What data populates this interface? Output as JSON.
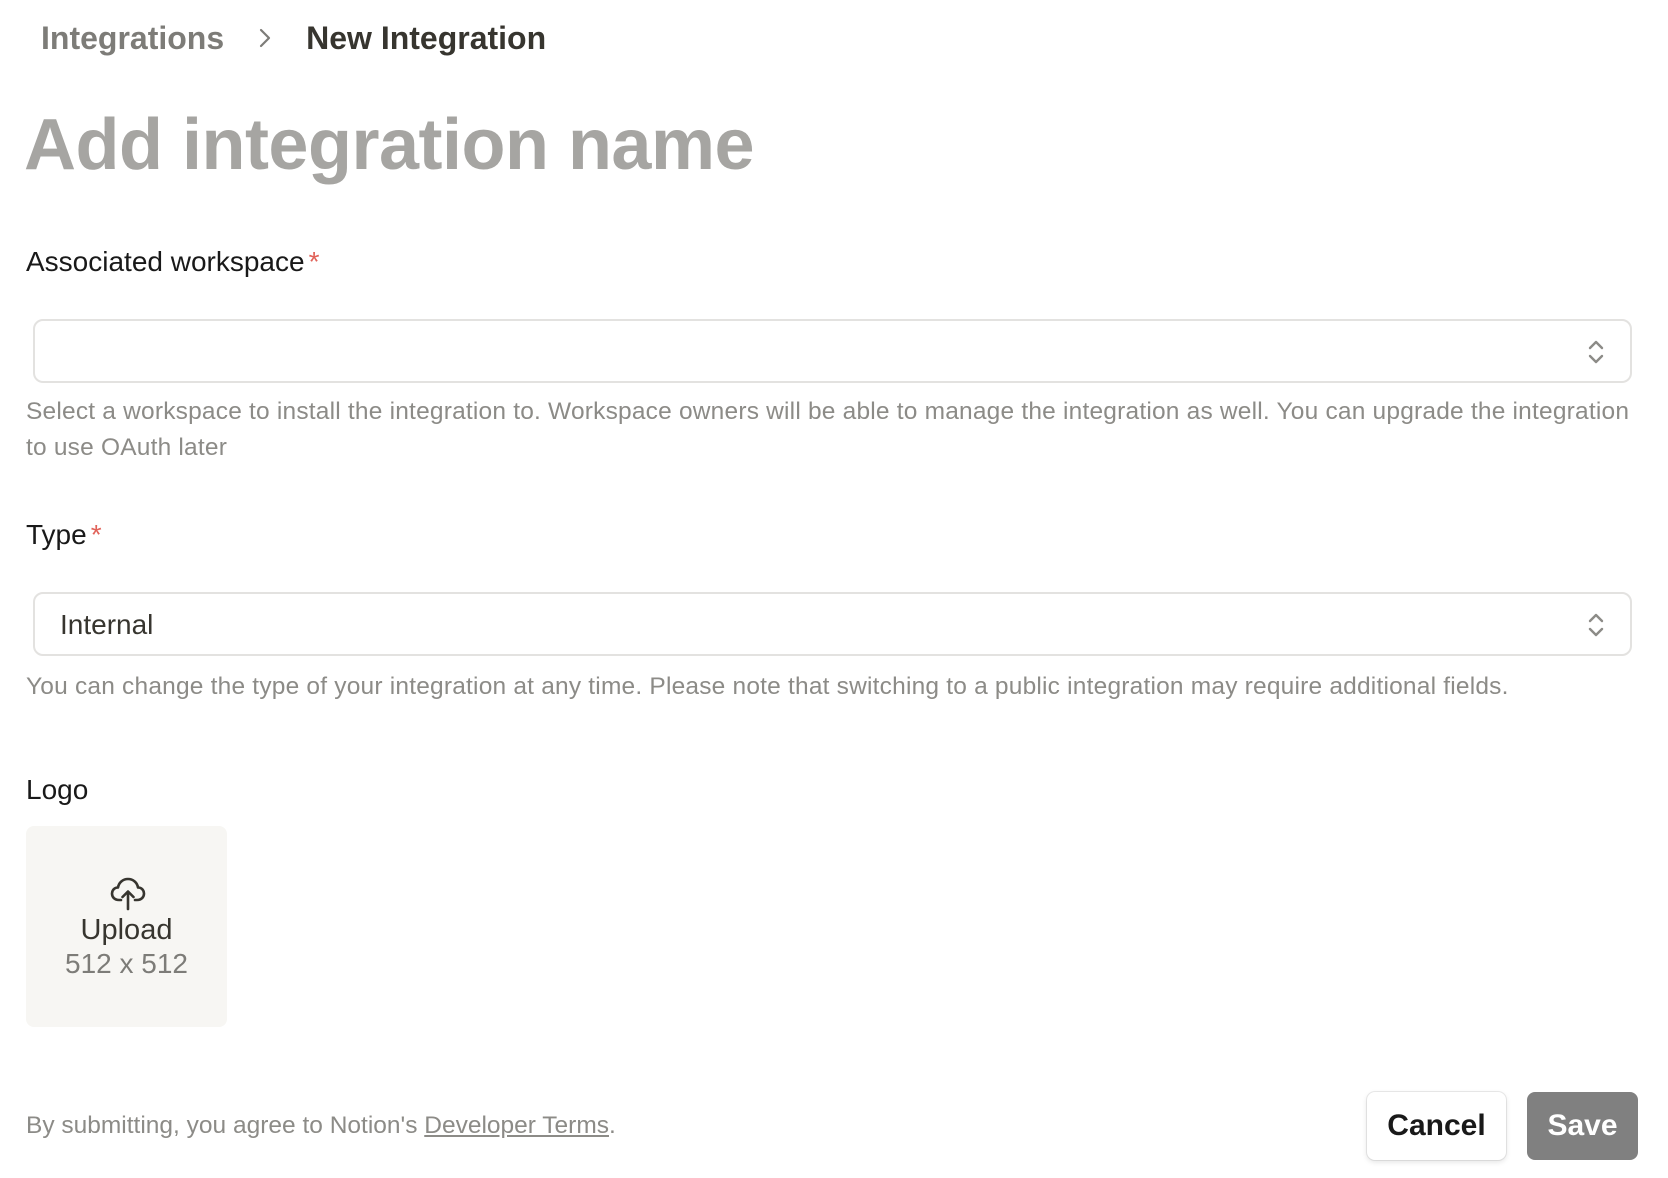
{
  "breadcrumb": {
    "root": "Integrations",
    "current": "New Integration"
  },
  "title_placeholder": "Add integration name",
  "workspace": {
    "label": "Associated workspace",
    "required_mark": "*",
    "value": "",
    "helper": "Select a workspace to install the integration to. Workspace owners will be able to manage the integration as well. You can upgrade the integration to use OAuth later"
  },
  "type": {
    "label": "Type",
    "required_mark": "*",
    "value": "Internal",
    "helper": "You can change the type of your integration at any time. Please note that switching to a public integration may require additional fields."
  },
  "logo": {
    "label": "Logo",
    "upload_label": "Upload",
    "size_hint": "512 x 512"
  },
  "footer": {
    "note_prefix": "By submitting, you agree to Notion's ",
    "link_text": "Developer Terms",
    "note_suffix": ".",
    "cancel_label": "Cancel",
    "save_label": "Save"
  },
  "colors": {
    "required": "#e16259",
    "save_button": "#808080",
    "upload_background": "#f7f6f3"
  },
  "icons": {
    "breadcrumb_separator": "chevron-right-icon",
    "select_indicator": "chevron-up-down-icon",
    "upload": "cloud-upload-icon"
  }
}
